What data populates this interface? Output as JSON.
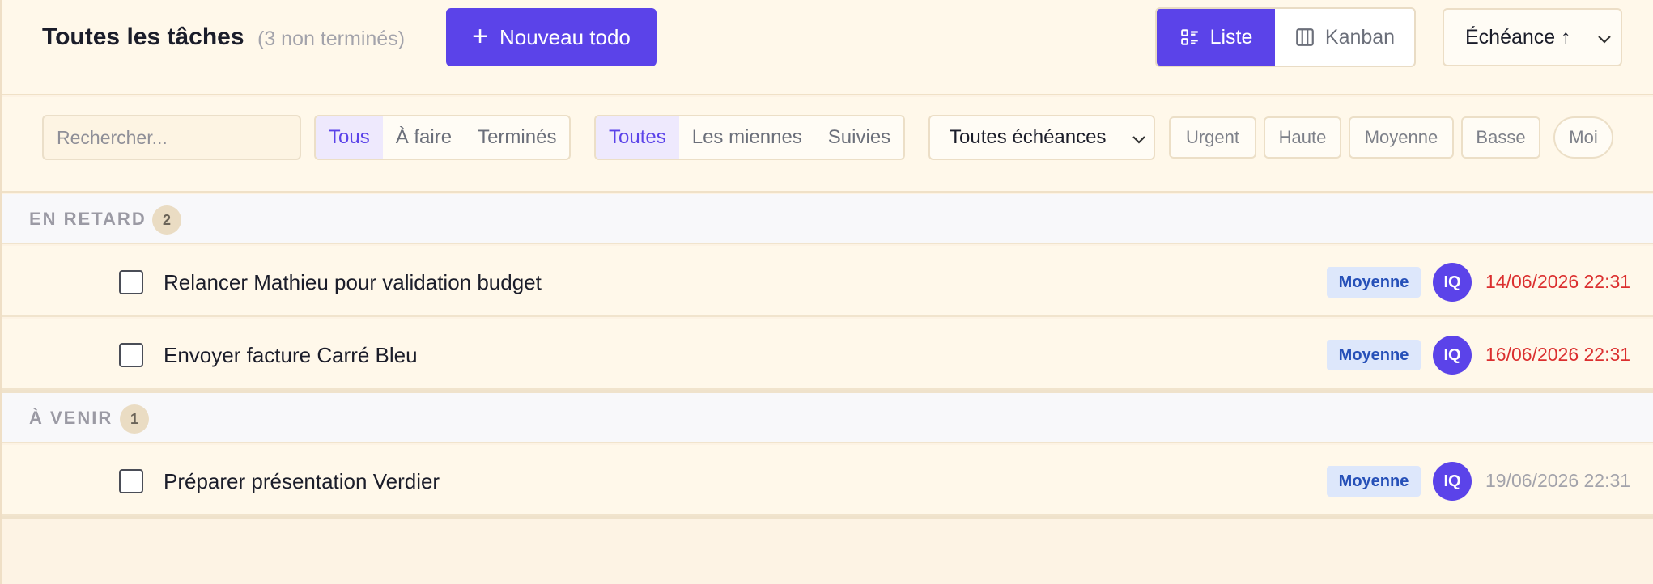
{
  "header": {
    "title": "Toutes les tâches",
    "count_text": "(3 non terminés)",
    "new_todo_label": "Nouveau todo",
    "view_toggle": {
      "list_label": "Liste",
      "kanban_label": "Kanban",
      "active": "list"
    },
    "sort": {
      "selected": "Échéance ↑"
    }
  },
  "filters": {
    "search": {
      "placeholder": "Rechercher..."
    },
    "status": {
      "options": [
        "Tous",
        "À faire",
        "Terminés"
      ],
      "selected": "Tous"
    },
    "scope": {
      "options": [
        "Toutes",
        "Les miennes",
        "Suivies"
      ],
      "selected": "Toutes"
    },
    "due": {
      "selected": "Toutes échéances"
    },
    "priorities": [
      "Urgent",
      "Haute",
      "Moyenne",
      "Basse"
    ],
    "me_label": "Moi"
  },
  "sections": [
    {
      "label": "EN RETARD",
      "count": "2",
      "tasks": [
        {
          "title": "Relancer Mathieu pour validation budget",
          "priority": "Moyenne",
          "assignee": "IQ",
          "due": "14/06/2026 22:31",
          "state": "overdue"
        },
        {
          "title": "Envoyer facture Carré Bleu",
          "priority": "Moyenne",
          "assignee": "IQ",
          "due": "16/06/2026 22:31",
          "state": "overdue"
        }
      ]
    },
    {
      "label": "À VENIR",
      "count": "1",
      "tasks": [
        {
          "title": "Préparer présentation Verdier",
          "priority": "Moyenne",
          "assignee": "IQ",
          "due": "19/06/2026 22:31",
          "state": "upcoming"
        }
      ]
    }
  ],
  "colors": {
    "accent": "#5b43e9",
    "background": "#fdf3e4",
    "overdue": "#db2f2f",
    "priority_medium_bg": "#dde7fb",
    "priority_medium_text": "#2650b8"
  }
}
